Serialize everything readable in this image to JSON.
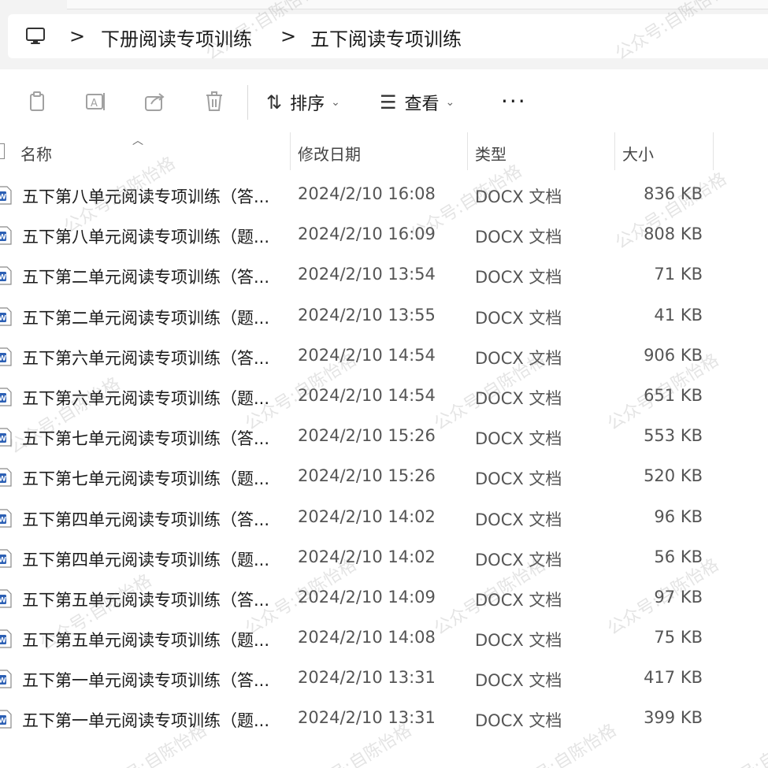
{
  "breadcrumb": {
    "items": [
      "下册阅读专项训练",
      "五下阅读专项训练"
    ],
    "separator": ">"
  },
  "toolbar": {
    "icons": [
      "copy-icon",
      "rename-icon",
      "share-icon",
      "delete-icon"
    ],
    "sort_label": "排序",
    "view_label": "查看",
    "more_label": "···"
  },
  "columns": {
    "name": "名称",
    "date": "修改日期",
    "type": "类型",
    "size": "大小"
  },
  "files": [
    {
      "name": "五下第八单元阅读专项训练（答...",
      "date": "2024/2/10 16:08",
      "type": "DOCX 文档",
      "size": "836 KB"
    },
    {
      "name": "五下第八单元阅读专项训练（题...",
      "date": "2024/2/10 16:09",
      "type": "DOCX 文档",
      "size": "808 KB"
    },
    {
      "name": "五下第二单元阅读专项训练（答...",
      "date": "2024/2/10 13:54",
      "type": "DOCX 文档",
      "size": "71 KB"
    },
    {
      "name": "五下第二单元阅读专项训练（题...",
      "date": "2024/2/10 13:55",
      "type": "DOCX 文档",
      "size": "41 KB"
    },
    {
      "name": "五下第六单元阅读专项训练（答...",
      "date": "2024/2/10 14:54",
      "type": "DOCX 文档",
      "size": "906 KB"
    },
    {
      "name": "五下第六单元阅读专项训练（题...",
      "date": "2024/2/10 14:54",
      "type": "DOCX 文档",
      "size": "651 KB"
    },
    {
      "name": "五下第七单元阅读专项训练（答...",
      "date": "2024/2/10 15:26",
      "type": "DOCX 文档",
      "size": "553 KB"
    },
    {
      "name": "五下第七单元阅读专项训练（题...",
      "date": "2024/2/10 15:26",
      "type": "DOCX 文档",
      "size": "520 KB"
    },
    {
      "name": "五下第四单元阅读专项训练（答...",
      "date": "2024/2/10 14:02",
      "type": "DOCX 文档",
      "size": "96 KB"
    },
    {
      "name": "五下第四单元阅读专项训练（题...",
      "date": "2024/2/10 14:02",
      "type": "DOCX 文档",
      "size": "56 KB"
    },
    {
      "name": "五下第五单元阅读专项训练（答...",
      "date": "2024/2/10 14:09",
      "type": "DOCX 文档",
      "size": "97 KB"
    },
    {
      "name": "五下第五单元阅读专项训练（题...",
      "date": "2024/2/10 14:08",
      "type": "DOCX 文档",
      "size": "75 KB"
    },
    {
      "name": "五下第一单元阅读专项训练（答...",
      "date": "2024/2/10 13:31",
      "type": "DOCX 文档",
      "size": "417 KB"
    },
    {
      "name": "五下第一单元阅读专项训练（题...",
      "date": "2024/2/10 13:31",
      "type": "DOCX 文档",
      "size": "399 KB"
    }
  ],
  "watermark": "公众号:自陈怡格",
  "colors": {
    "word_blue": "#2b5fb4",
    "header_text": "#444444",
    "secondary_text": "#555555"
  }
}
